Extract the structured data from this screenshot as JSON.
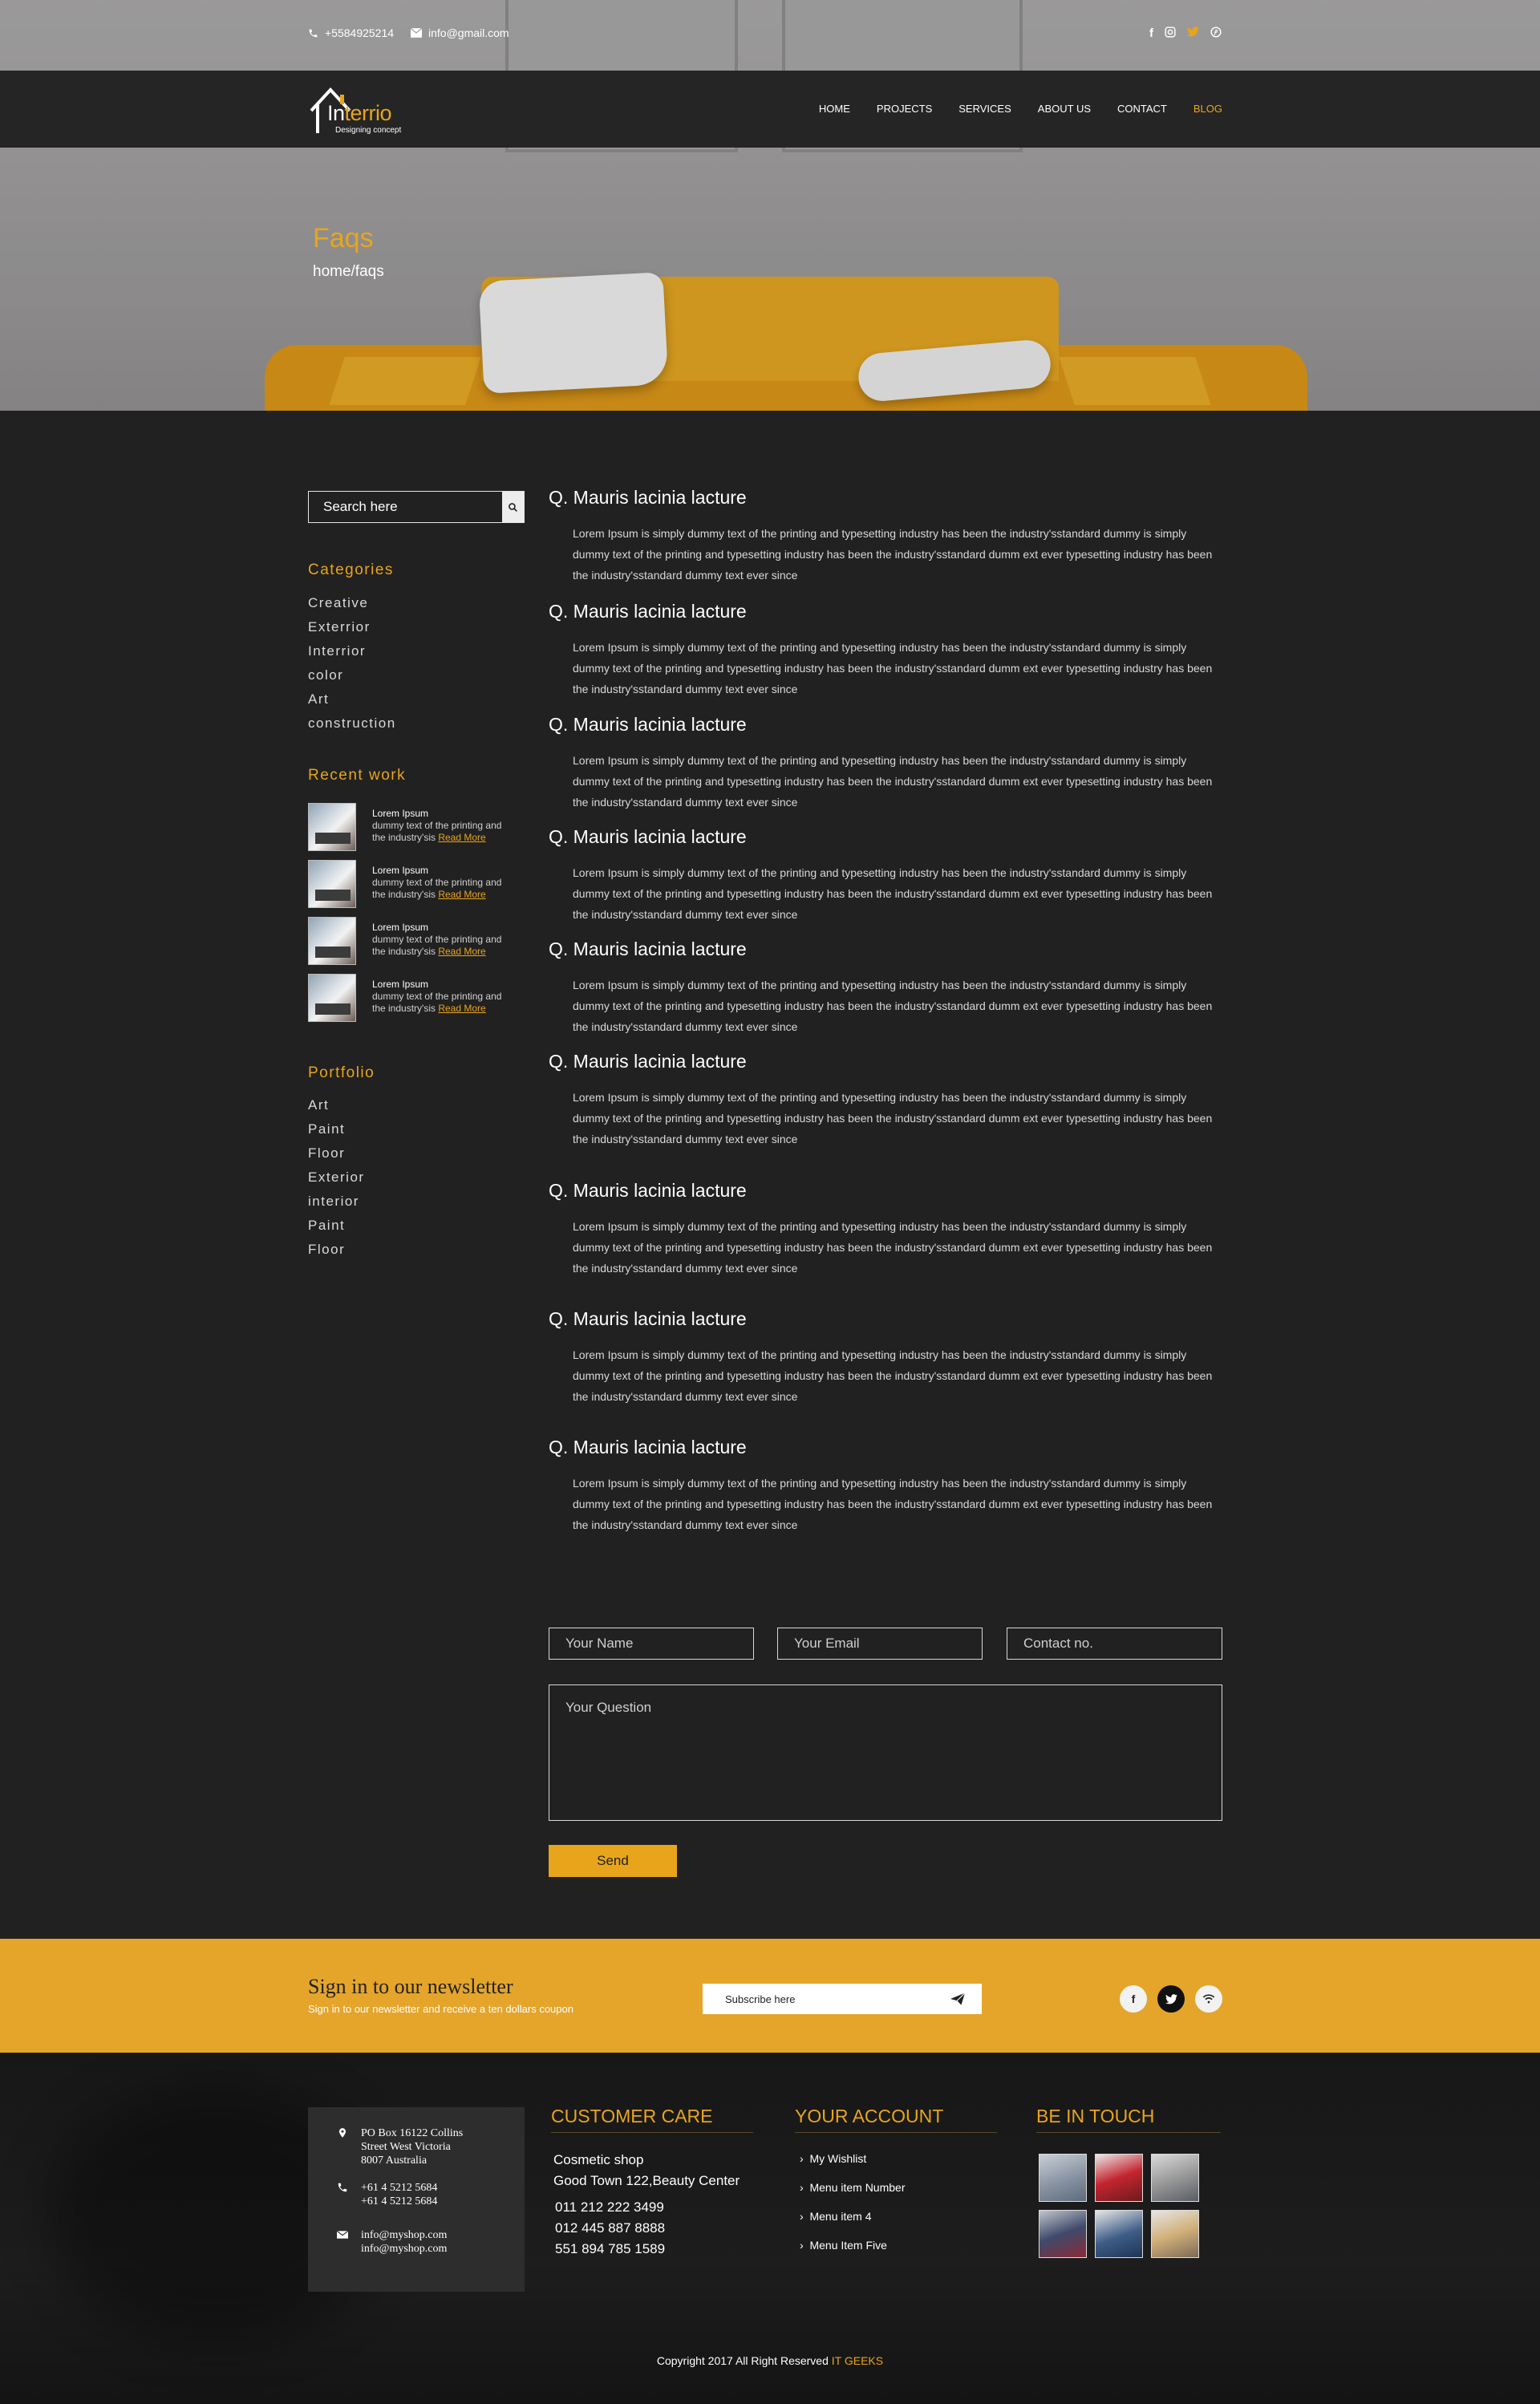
{
  "topbar": {
    "phone": "+5584925214",
    "email": "info@gmail.com",
    "social": [
      "facebook-icon",
      "instagram-icon",
      "twitter-icon",
      "pinterest-icon"
    ]
  },
  "brand": {
    "logo_i": "In",
    "logo_rest": "terrio",
    "tagline": "Designing concept",
    "accent": "#e8a51b"
  },
  "nav": [
    {
      "label": "HOME",
      "active": false
    },
    {
      "label": "PROJECTS",
      "active": false
    },
    {
      "label": "SERVICES",
      "active": false
    },
    {
      "label": "ABOUT US",
      "active": false
    },
    {
      "label": "CONTACT",
      "active": false
    },
    {
      "label": "BLOG",
      "active": true
    }
  ],
  "hero": {
    "title": "Faqs",
    "breadcrumb": "home/faqs"
  },
  "sidebar": {
    "search_placeholder": "Search here",
    "categories_title": "Categories",
    "categories": [
      "Creative",
      "Exterrior",
      "Interrior",
      "color",
      "Art",
      "construction"
    ],
    "recent_title": "Recent work",
    "recent": [
      {
        "title": "Lorem Ipsum",
        "line1": "dummy text of the printing and",
        "line2": "the industry'sis",
        "link": "Read More"
      },
      {
        "title": "Lorem Ipsum",
        "line1": "dummy text of the printing and",
        "line2": "the industry'sis",
        "link": "Read More"
      },
      {
        "title": "Lorem Ipsum",
        "line1": "dummy text of the printing and",
        "line2": "the industry'sis",
        "link": "Read More"
      },
      {
        "title": "Lorem Ipsum",
        "line1": "dummy text of the printing and",
        "line2": "the industry'sis",
        "link": "Read More"
      }
    ],
    "portfolio_title": "Portfolio",
    "portfolio": [
      "Art",
      "Paint",
      "Floor",
      "Exterior",
      "interior",
      "Paint",
      "Floor"
    ]
  },
  "faqs": [
    {
      "q": "Q. Mauris lacinia lacture",
      "a": "Lorem Ipsum is simply dummy text of the printing  and typesetting industry has been the industry'sstandard dummy is simply dummy text of the printing  and typesetting industry has been the industry'sstandard dumm ext ever typesetting industry has been the industry'sstandard dummy text ever since"
    },
    {
      "q": "Q. Mauris lacinia lacture",
      "a": "Lorem Ipsum is simply dummy text of the printing  and typesetting industry has been the industry'sstandard dummy is simply dummy text of the printing  and typesetting industry has been the industry'sstandard dumm ext ever typesetting industry has been the industry'sstandard dummy text ever since"
    },
    {
      "q": "Q. Mauris lacinia lacture",
      "a": "Lorem Ipsum is simply dummy text of the printing  and typesetting industry has been the industry'sstandard dummy is simply dummy text of the printing  and typesetting industry has been the industry'sstandard dumm ext ever typesetting industry has been the industry'sstandard dummy text ever since"
    },
    {
      "q": "Q. Mauris lacinia lacture",
      "a": "Lorem Ipsum is simply dummy text of the printing  and typesetting industry has been the industry'sstandard dummy is simply dummy text of the printing  and typesetting industry has been the industry'sstandard dumm ext ever typesetting industry has been the industry'sstandard dummy text ever since"
    },
    {
      "q": "Q. Mauris lacinia lacture",
      "a": "Lorem Ipsum is simply dummy text of the printing  and typesetting industry has been the industry'sstandard dummy is simply dummy text of the printing  and typesetting industry has been the industry'sstandard dumm ext ever typesetting industry has been the industry'sstandard dummy text ever since"
    },
    {
      "q": "Q. Mauris lacinia lacture",
      "a": "Lorem Ipsum is simply dummy text of the printing  and typesetting industry has been the industry'sstandard dummy is simply dummy text of the printing  and typesetting industry has been the industry'sstandard dumm ext ever typesetting industry has been the industry'sstandard dummy text ever since"
    },
    {
      "q": "Q. Mauris lacinia lacture",
      "a": "Lorem Ipsum is simply dummy text of the printing  and typesetting industry has been the industry'sstandard dummy is simply dummy text of the printing  and typesetting industry has been the industry'sstandard dumm ext ever typesetting industry has been the industry'sstandard dummy text ever since"
    },
    {
      "q": "Q. Mauris lacinia lacture",
      "a": "Lorem Ipsum is simply dummy text of the printing  and typesetting industry has been the industry'sstandard dummy is simply dummy text of the printing  and typesetting industry has been the industry'sstandard dumm ext ever typesetting industry has been the industry'sstandard dummy text ever since"
    },
    {
      "q": "Q. Mauris lacinia lacture",
      "a": "Lorem Ipsum is simply dummy text of the printing  and typesetting industry has been the industry'sstandard dummy is simply dummy text of the printing  and typesetting industry has been the industry'sstandard dumm ext ever typesetting industry has been the industry'sstandard dummy text ever since"
    }
  ],
  "form": {
    "name_placeholder": "Your Name",
    "email_placeholder": "Your Email",
    "contact_placeholder": "Contact no.",
    "question_placeholder": "Your Question",
    "send_label": "Send"
  },
  "newsletter": {
    "title": "Sign in to our newsletter",
    "subtitle": "Sign in to our newsletter and receive a ten  dollars coupon",
    "placeholder": "Subscribe here",
    "social": [
      "facebook-icon",
      "twitter-icon",
      "rss-icon"
    ]
  },
  "footer": {
    "address_lines": [
      "PO Box 16122 Collins",
      "Street West Victoria",
      " 8007 Australia"
    ],
    "phones": [
      "+61 4 5212 5684",
      "+61 4 5212 5684"
    ],
    "emails": [
      "info@myshop.com",
      "info@myshop.com"
    ],
    "customer_care_title": "CUSTOMER CARE",
    "customer_care_lines": [
      "Cosmetic shop",
      "Good Town 122,Beauty Center"
    ],
    "customer_care_phones": [
      "011 212 222 3499",
      "012 445 887 8888",
      "551 894 785 1589"
    ],
    "account_title": "YOUR ACCOUNT",
    "account_links": [
      "My Wishlist",
      "Menu item Number",
      "Menu item 4",
      "Menu Item Five"
    ],
    "touch_title": "BE IN TOUCH",
    "copyright": "Copyright 2017  All Right Reserved ",
    "copyright_brand": "IT GEEKS"
  }
}
